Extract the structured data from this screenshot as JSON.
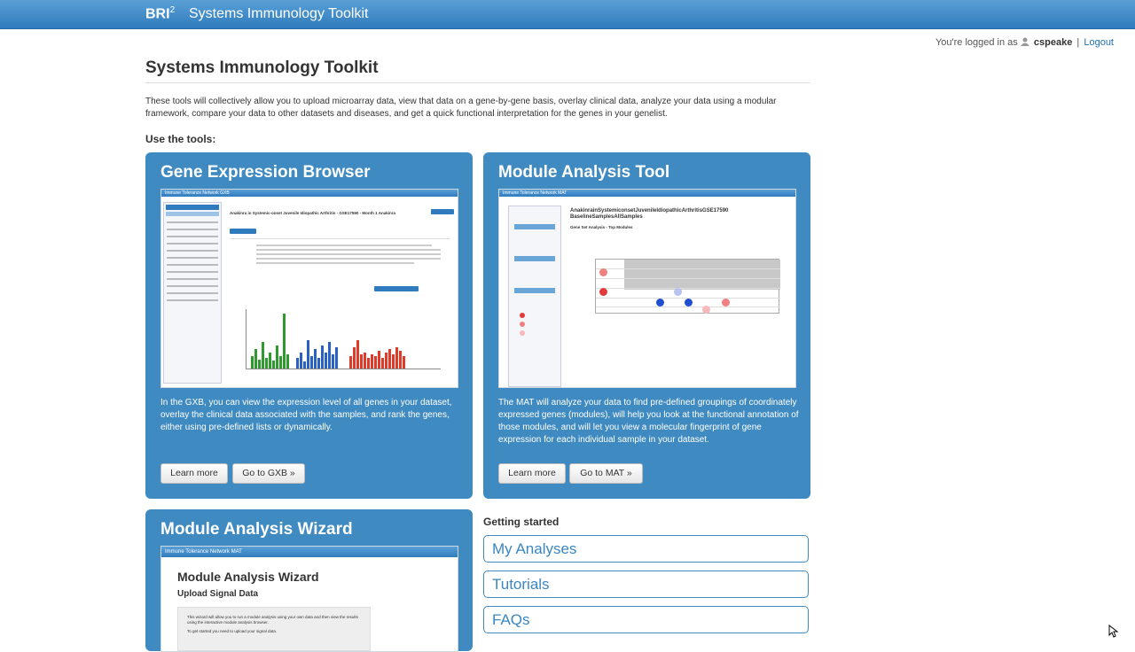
{
  "topbar": {
    "brand": "BRI",
    "brand_sup": "2",
    "title": "Systems Immunology Toolkit"
  },
  "login": {
    "prefix": "You're logged in as",
    "user": "cspeake",
    "separator": "|",
    "logout": "Logout"
  },
  "page": {
    "title": "Systems Immunology Toolkit",
    "intro": "These tools will collectively allow you to upload microarray data, view that data on a gene-by-gene basis, overlay clinical data, analyze your data using a modular framework, compare your data to other datasets and diseases, and get a quick functional interpretation for the genes in your genelist.",
    "use_tools": "Use the tools:"
  },
  "cards": {
    "gxb": {
      "title": "Gene Expression Browser",
      "desc": "In the GXB, you can view the expression level of all genes in your dataset, overlay the clinical data associated with the samples, and rank the genes, either using pre-defined lists or dynamically.",
      "learn_more": "Learn more",
      "go": "Go to GXB »",
      "shot_header": "Immune Tolerance Network  GXB",
      "shot_heading": "Anakinra in Systemic-onset Juvenile Idiopathic Arthritis - GSE17590 - Month 1 Anakinra"
    },
    "mat": {
      "title": "Module Analysis Tool",
      "desc": "The MAT will analyze your data to find pre-defined groupings of coordinately expressed genes (modules), will help you look at the functional annotation of those modules, and will let you view a molecular fingerprint of gene expression for each individual sample in your dataset.",
      "learn_more": "Learn more",
      "go": "Go to MAT »",
      "shot_header": "Immune Tolerance Network  MAT",
      "shot_heading": "AnakinrainSystemiconsetJuvenileIdiopathicArthritisGSE17590 BaselineSamplesAllSamples",
      "shot_subheading": "Gene Set Analysis - Top Modules"
    },
    "wizard": {
      "title": "Module Analysis Wizard",
      "shot_header": "Immune Tolerance Network  MAT",
      "shot_heading": "Module Analysis Wizard",
      "shot_subheading": "Upload Signal Data",
      "shot_text1": "This wizard will allow you to run a module analysis using your own data and then view the results using the interactive module analysis browser.",
      "shot_text2": "To get started you need to upload your signal data."
    }
  },
  "getting_started": {
    "heading": "Getting started",
    "links": [
      "My Analyses",
      "Tutorials",
      "FAQs"
    ]
  },
  "colors": {
    "card_bg": "#3f8ac1",
    "topbar": "#3a87c8",
    "link": "#3a86c3"
  }
}
